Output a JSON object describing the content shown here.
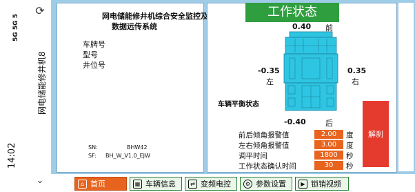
{
  "statusbar": {
    "time": "14:02",
    "indicators": "5G 5G 5",
    "app_title": "网电储能修井机8"
  },
  "left_panel": {
    "title_line1": "网电储能修井机综合安全监控及",
    "title_line2": "数据远传系统",
    "plate_label": "车牌号",
    "model_label": "型号",
    "well_label": "井位号",
    "sn_label": "SN:",
    "sn_value": "BHW42",
    "sf_label": "SF:",
    "sf_value": "BH_W_V1.0_EJW"
  },
  "status": {
    "banner": "工作状态",
    "front_value": "0.40",
    "front_label": "前",
    "rear_value": "-0.40",
    "rear_label": "后",
    "left_value": "-0.35",
    "left_label": "左",
    "right_value": "0.35",
    "right_label": "右",
    "balance_label": "车辆平衡状态",
    "vehicle_color": "#2ec5e3"
  },
  "settings": [
    {
      "label": "前后倾角报警值",
      "value": "2.00",
      "unit": "度"
    },
    {
      "label": "左右倾角报警值",
      "value": "3.00",
      "unit": "度"
    },
    {
      "label": "调平时间",
      "value": "1800",
      "unit": "秒"
    },
    {
      "label": "工作状态确认时间",
      "value": "30",
      "unit": "秒"
    }
  ],
  "release_button": "解刹",
  "nav": {
    "home": "首页",
    "vehicle_info": "车辆信息",
    "vfd": "变频电控",
    "params": "参数设置",
    "video": "锁销视频"
  },
  "colors": {
    "accent_orange": "#e8641e",
    "banner_green": "#2f9e3f",
    "release_red": "#e53b2f",
    "panel_blue": "#9fcde8"
  }
}
